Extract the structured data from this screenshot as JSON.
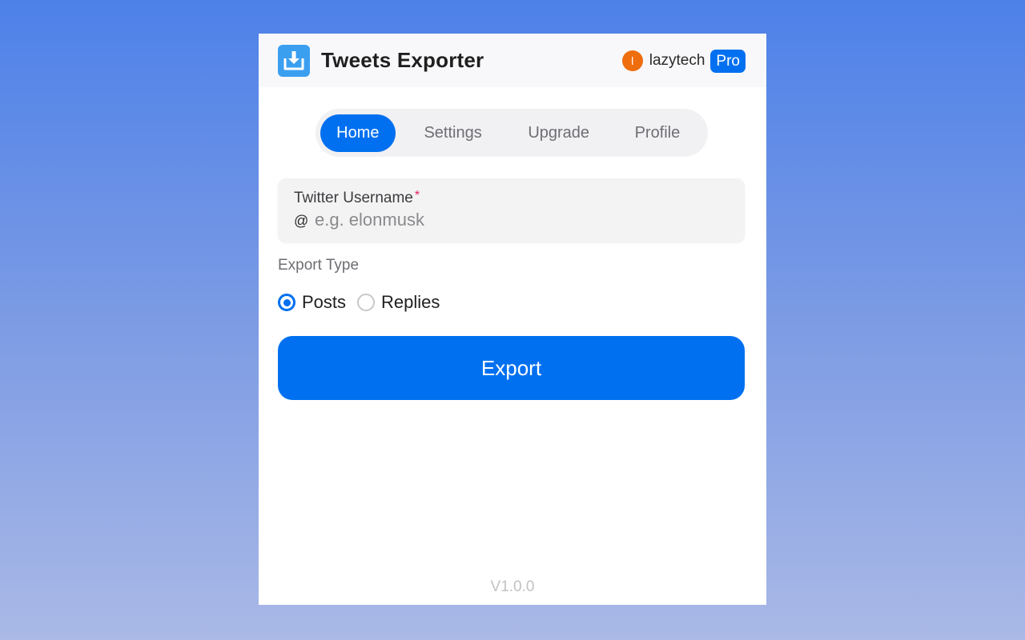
{
  "app": {
    "title": "Tweets Exporter",
    "logo_icon": "download-tray-icon"
  },
  "user": {
    "avatar_initial": "l",
    "name": "lazytech",
    "badge": "Pro"
  },
  "tabs": [
    {
      "label": "Home",
      "active": true
    },
    {
      "label": "Settings",
      "active": false
    },
    {
      "label": "Upgrade",
      "active": false
    },
    {
      "label": "Profile",
      "active": false
    }
  ],
  "form": {
    "username_label": "Twitter Username",
    "required_mark": "*",
    "prefix": "@",
    "username_value": "",
    "username_placeholder": "e.g. elonmusk",
    "export_type_label": "Export Type",
    "options": [
      {
        "label": "Posts",
        "checked": true
      },
      {
        "label": "Replies",
        "checked": false
      }
    ],
    "export_button": "Export"
  },
  "footer": {
    "version": "V1.0.0"
  },
  "colors": {
    "accent": "#0070f0",
    "avatar": "#ee6d0d",
    "logo": "#3b9ff0",
    "required": "#e0245e"
  }
}
